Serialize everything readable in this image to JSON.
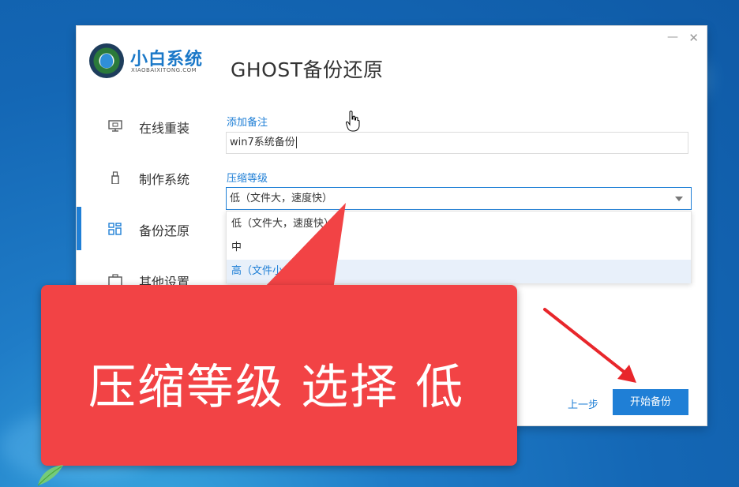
{
  "window": {
    "minimize_glyph": "—",
    "close_glyph": "✕"
  },
  "brand": {
    "name": "小白系统",
    "sub": "XIAOBAIXITONG.COM"
  },
  "page_title": "GHOST备份还原",
  "sidebar": {
    "items": [
      {
        "label": "在线重装",
        "icon": "monitor-icon"
      },
      {
        "label": "制作系统",
        "icon": "usb-icon"
      },
      {
        "label": "备份还原",
        "icon": "grid-icon",
        "active": true
      },
      {
        "label": "其他设置",
        "icon": "briefcase-icon"
      }
    ]
  },
  "form": {
    "note_label": "添加备注",
    "note_value": "win7系统备份",
    "level_label": "压缩等级",
    "level_selected": "低（文件大，速度快）",
    "level_options": [
      {
        "label": "低（文件大，速度快）"
      },
      {
        "label": "中"
      },
      {
        "label": "高（文件小，速"
      }
    ]
  },
  "buttons": {
    "prev": "上一步",
    "start": "开始备份"
  },
  "callout": {
    "text": "压缩等级 选择 低"
  },
  "colors": {
    "accent": "#1f7fd6",
    "callout": "#f24345"
  }
}
